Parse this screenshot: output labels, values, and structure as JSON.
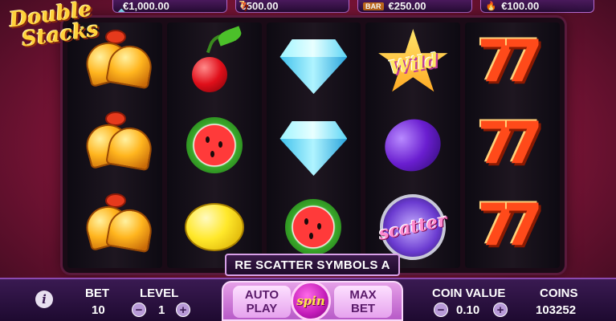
{
  "logo": {
    "line1": "Double",
    "line2": "Stacks"
  },
  "jackpots": [
    {
      "icon": "diamond-icon",
      "glyph": "◆",
      "amount": "€1,000.00"
    },
    {
      "icon": "seven-icon",
      "glyph": "7",
      "amount": "€500.00"
    },
    {
      "icon": "bar-icon",
      "glyph": "BAR",
      "amount": "€250.00"
    },
    {
      "icon": "fire-icon",
      "glyph": "🔥",
      "amount": "€100.00"
    }
  ],
  "reels": [
    [
      "bell",
      "bell",
      "bell"
    ],
    [
      "cherry",
      "watermelon",
      "lemon"
    ],
    [
      "diamond",
      "diamond",
      "watermelon"
    ],
    [
      "wild",
      "plum",
      "scatter"
    ],
    [
      "sevens",
      "sevens",
      "sevens"
    ]
  ],
  "symbols": {
    "wild_text": "Wild",
    "scatter_text": "scatter"
  },
  "message": "RE SCATTER SYMBOLS A",
  "controls": {
    "info": "i",
    "bet_label": "BET",
    "bet_value": "10",
    "level_label": "LEVEL",
    "level_value": "1",
    "minus": "−",
    "plus": "+",
    "auto_line1": "AUTO",
    "auto_line2": "PLAY",
    "spin": "spin",
    "max_line1": "MAX",
    "max_line2": "BET",
    "coin_value_label": "COIN VALUE",
    "coin_value": "0.10",
    "coins_label": "COINS",
    "coins_value": "103252"
  }
}
